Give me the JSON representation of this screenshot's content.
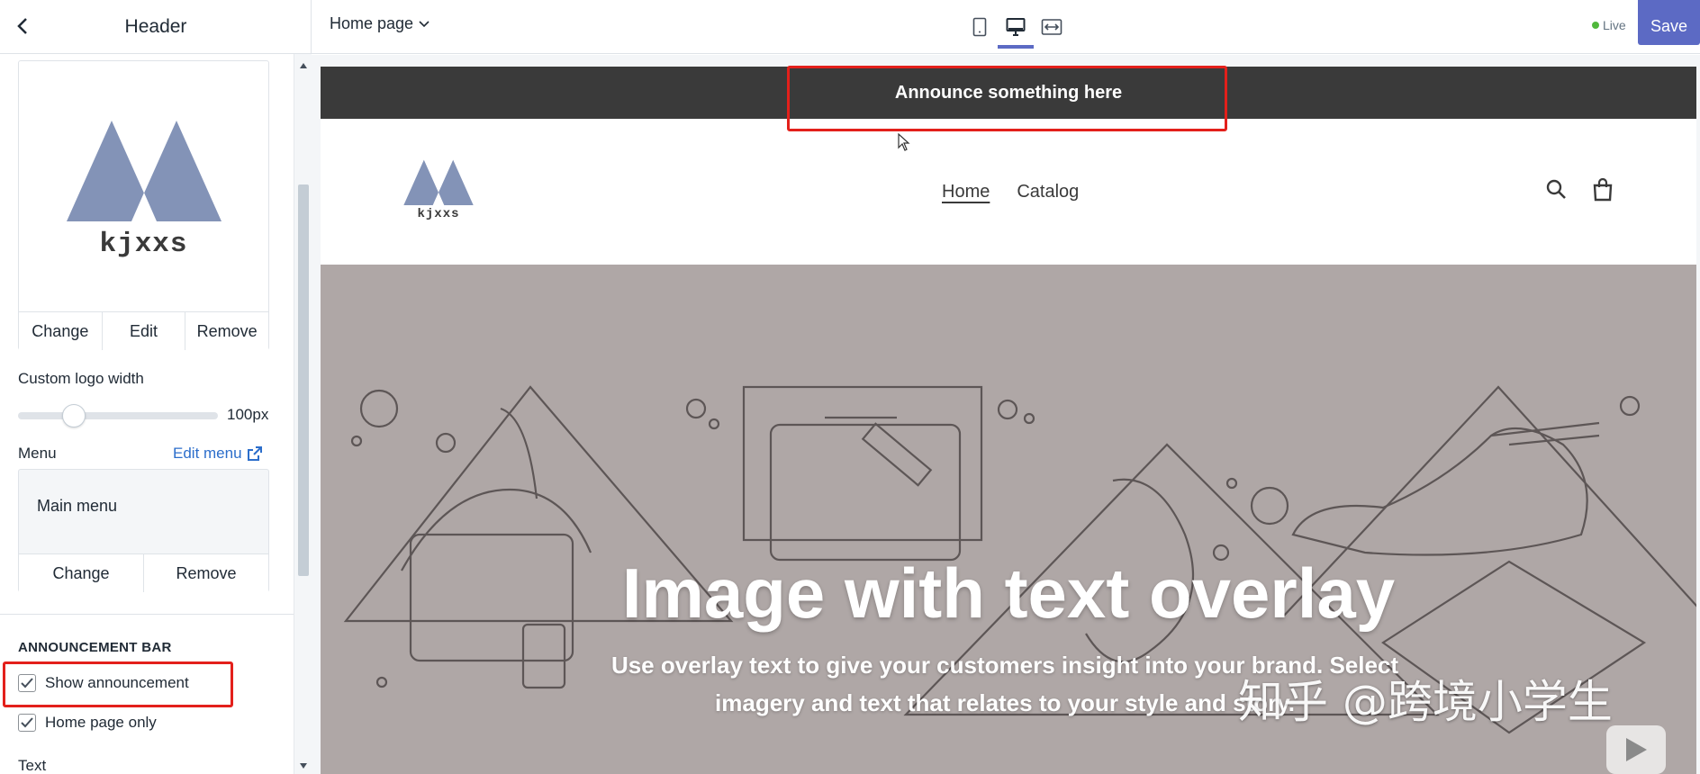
{
  "sidebar": {
    "title": "Header",
    "logo": {
      "word": "kjxxs",
      "buttons": [
        "Change",
        "Edit",
        "Remove"
      ]
    },
    "logo_width": {
      "label": "Custom logo width",
      "value": "100px",
      "fraction": 0.25
    },
    "menu": {
      "label": "Menu",
      "edit_link": "Edit menu",
      "name": "Main menu",
      "buttons": [
        "Change",
        "Remove"
      ]
    },
    "announcement": {
      "section_title": "ANNOUNCEMENT BAR",
      "show_label": "Show announcement",
      "show_checked": true,
      "home_only_label": "Home page only",
      "home_only_checked": true,
      "text_label": "Text"
    }
  },
  "topbar": {
    "page_select": "Home page",
    "live_label": "Live",
    "save_label": "Save"
  },
  "preview": {
    "announcement_text": "Announce something here",
    "store_logo_word": "kjxxs",
    "nav": [
      "Home",
      "Catalog"
    ],
    "hero_title": "Image with text overlay",
    "hero_subtitle": "Use overlay text to give your customers insight into your brand. Select imagery and text that relates to your style and story."
  },
  "watermark": "知乎 @跨境小学生",
  "colors": {
    "accent": "#5c6ac4",
    "announcement_bg": "#3a3a3a",
    "hero_bg": "#afa7a6",
    "highlight": "#e3201b",
    "link": "#2c6ecb",
    "live": "#50b83c"
  }
}
